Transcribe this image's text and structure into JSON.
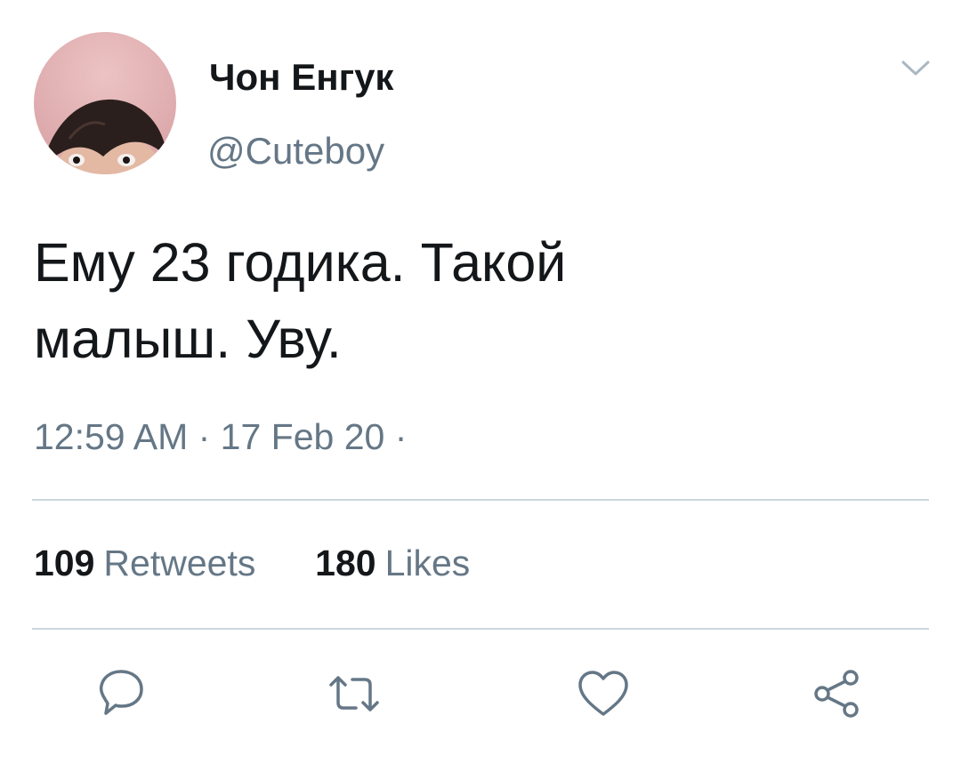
{
  "tweet": {
    "author": {
      "display_name": "Чон Енгук",
      "handle": "@Cuteboy",
      "avatar_icon": "user-avatar-photo"
    },
    "text_lines": [
      "Ему 23 годика. Такой",
      "малыш. Уву."
    ],
    "timestamp": "12:59 AM · 17 Feb 20 ·",
    "stats": {
      "retweets_count": "109",
      "retweets_label": "Retweets",
      "likes_count": "180",
      "likes_label": "Likes"
    },
    "actions": [
      {
        "name": "reply",
        "icon": "speech-bubble-icon"
      },
      {
        "name": "retweet",
        "icon": "retweet-arrows-icon"
      },
      {
        "name": "like",
        "icon": "heart-icon"
      },
      {
        "name": "share",
        "icon": "share-nodes-icon"
      }
    ],
    "menu_icon": "chevron-down-icon"
  },
  "colors": {
    "primary_text": "#14171a",
    "secondary_text": "#657786",
    "divider": "#ccd6dd",
    "icon": "#657786",
    "avatar_background": "#e2b3b3"
  }
}
